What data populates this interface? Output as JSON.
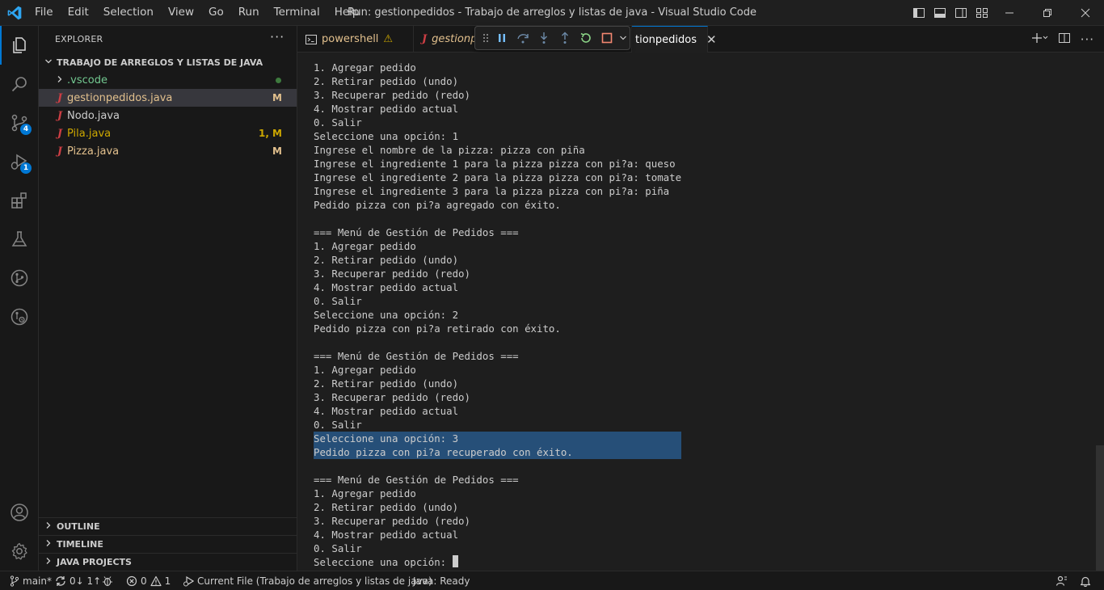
{
  "window": {
    "title": "Run: gestionpedidos - Trabajo de arreglos y listas de java - Visual Studio Code"
  },
  "menu": [
    "File",
    "Edit",
    "Selection",
    "View",
    "Go",
    "Run",
    "Terminal",
    "Help"
  ],
  "activity": {
    "source_control_badge": "4",
    "run_debug_badge": "1"
  },
  "explorer": {
    "header": "EXPLORER",
    "more": "···",
    "folder": "TRABAJO DE ARREGLOS Y LISTAS DE JAVA",
    "items": [
      {
        "name": ".vscode",
        "kind": "folder",
        "status": "",
        "color": "#73c991"
      },
      {
        "name": "gestionpedidos.java",
        "kind": "java",
        "status": "M",
        "color": "#e2c08d"
      },
      {
        "name": "Nodo.java",
        "kind": "java",
        "status": "",
        "color": "#cccccc"
      },
      {
        "name": "Pila.java",
        "kind": "java",
        "status": "1, M",
        "color": "#cca700"
      },
      {
        "name": "Pizza.java",
        "kind": "java",
        "status": "M",
        "color": "#e2c08d"
      }
    ],
    "sections": [
      "OUTLINE",
      "TIMELINE",
      "JAVA PROJECTS"
    ]
  },
  "tabs": [
    {
      "label": "powershell",
      "warning": "⚠"
    },
    {
      "label": "gestionp"
    },
    {
      "label": "tionpedidos",
      "close": "✕"
    }
  ],
  "terminal": {
    "lines": [
      "1. Agregar pedido",
      "2. Retirar pedido (undo)",
      "3. Recuperar pedido (redo)",
      "4. Mostrar pedido actual",
      "0. Salir",
      "Seleccione una opción: 1",
      "Ingrese el nombre de la pizza: pizza con piña",
      "Ingrese el ingrediente 1 para la pizza pizza con pi?a: queso",
      "Ingrese el ingrediente 2 para la pizza pizza con pi?a: tomate",
      "Ingrese el ingrediente 3 para la pizza pizza con pi?a: piña",
      "Pedido pizza con pi?a agregado con éxito.",
      "",
      "=== Menú de Gestión de Pedidos ===",
      "1. Agregar pedido",
      "2. Retirar pedido (undo)",
      "3. Recuperar pedido (redo)",
      "4. Mostrar pedido actual",
      "0. Salir",
      "Seleccione una opción: 2",
      "Pedido pizza con pi?a retirado con éxito.",
      "",
      "=== Menú de Gestión de Pedidos ===",
      "1. Agregar pedido",
      "2. Retirar pedido (undo)",
      "3. Recuperar pedido (redo)",
      "4. Mostrar pedido actual",
      "0. Salir",
      "Seleccione una opción: 3",
      "Pedido pizza con pi?a recuperado con éxito.",
      "",
      "=== Menú de Gestión de Pedidos ===",
      "1. Agregar pedido",
      "2. Retirar pedido (undo)",
      "3. Recuperar pedido (redo)",
      "4. Mostrar pedido actual",
      "0. Salir",
      "Seleccione una opción: "
    ],
    "highlighted": [
      27,
      28
    ]
  },
  "statusbar": {
    "branch": "main*",
    "sync": "0↓ 1↑",
    "errors": "0",
    "warnings": "1",
    "current_file": "Current File (Trabajo de arreglos y listas de java)",
    "java_status": "Java: Ready"
  },
  "colors": {
    "accent": "#0078d4",
    "selection": "#264f78",
    "java_icon": "#cc3e44",
    "warning": "#cca700",
    "modified": "#e2c08d"
  }
}
